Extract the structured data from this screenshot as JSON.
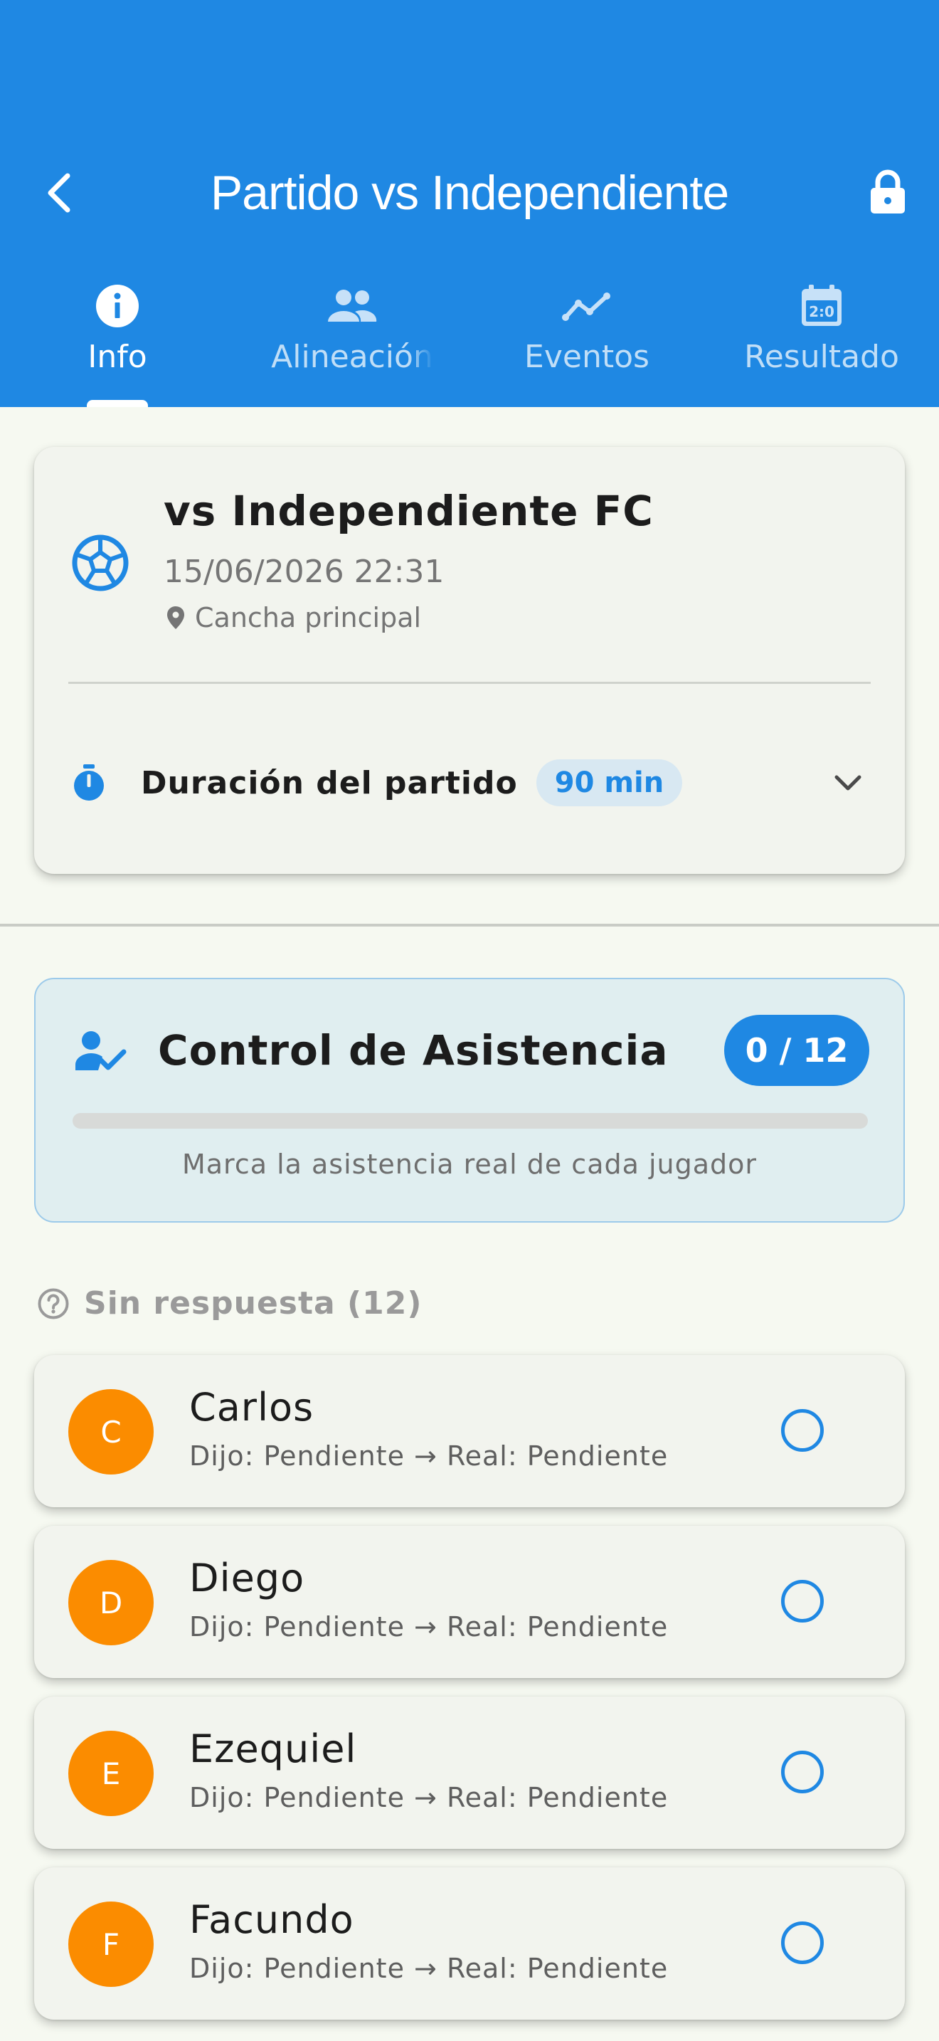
{
  "header": {
    "title": "Partido vs Independiente"
  },
  "tabs": [
    {
      "label": "Info",
      "icon": "info-icon",
      "active": true
    },
    {
      "label": "Alineación",
      "icon": "people-icon",
      "active": false
    },
    {
      "label": "Eventos",
      "icon": "trend-icon",
      "active": false
    },
    {
      "label": "Resultado",
      "icon": "scoreboard-icon",
      "active": false
    }
  ],
  "match": {
    "opponent": "vs Independiente FC",
    "datetime": "15/06/2026 22:31",
    "location": "Cancha principal",
    "duration_label": "Duración del partido",
    "duration_value": "90 min"
  },
  "attendance": {
    "title": "Control de Asistencia",
    "count": "0 / 12",
    "progress_fraction": 0,
    "subtitle": "Marca la asistencia real de cada jugador"
  },
  "group": {
    "title": "Sin respuesta (12)"
  },
  "players": [
    {
      "initial": "C",
      "name": "Carlos",
      "status": "Dijo: Pendiente → Real: Pendiente"
    },
    {
      "initial": "D",
      "name": "Diego",
      "status": "Dijo: Pendiente → Real: Pendiente"
    },
    {
      "initial": "E",
      "name": "Ezequiel",
      "status": "Dijo: Pendiente → Real: Pendiente"
    },
    {
      "initial": "F",
      "name": "Facundo",
      "status": "Dijo: Pendiente → Real: Pendiente"
    }
  ],
  "colors": {
    "primary": "#1f88e3",
    "avatar": "#fb8c00",
    "background": "#f6f9f1"
  }
}
